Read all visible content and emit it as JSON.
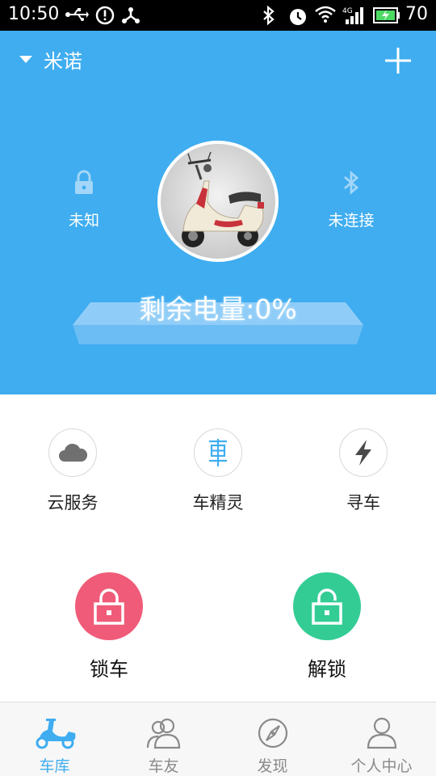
{
  "status_bar": {
    "time": "10:50",
    "battery_level": "70"
  },
  "header": {
    "vehicle_name": "米诺",
    "lock_status": "未知",
    "bluetooth_status": "未连接",
    "battery_remaining": "剩余电量:0%"
  },
  "services": [
    {
      "label": "云服务",
      "icon": "cloud-icon"
    },
    {
      "label": "车精灵",
      "icon": "car-spirit-icon"
    },
    {
      "label": "寻车",
      "icon": "lightning-icon"
    }
  ],
  "actions": {
    "lock": {
      "label": "锁车",
      "color": "#ef5b78"
    },
    "unlock": {
      "label": "解锁",
      "color": "#33cc95"
    }
  },
  "bottom_nav": [
    {
      "label": "车库",
      "icon": "scooter-icon",
      "active": true
    },
    {
      "label": "车友",
      "icon": "friends-icon",
      "active": false
    },
    {
      "label": "发现",
      "icon": "compass-icon",
      "active": false
    },
    {
      "label": "个人中心",
      "icon": "person-icon",
      "active": false
    }
  ],
  "colors": {
    "accent": "#3fadf0",
    "inactive_nav": "#8a8a8a"
  }
}
